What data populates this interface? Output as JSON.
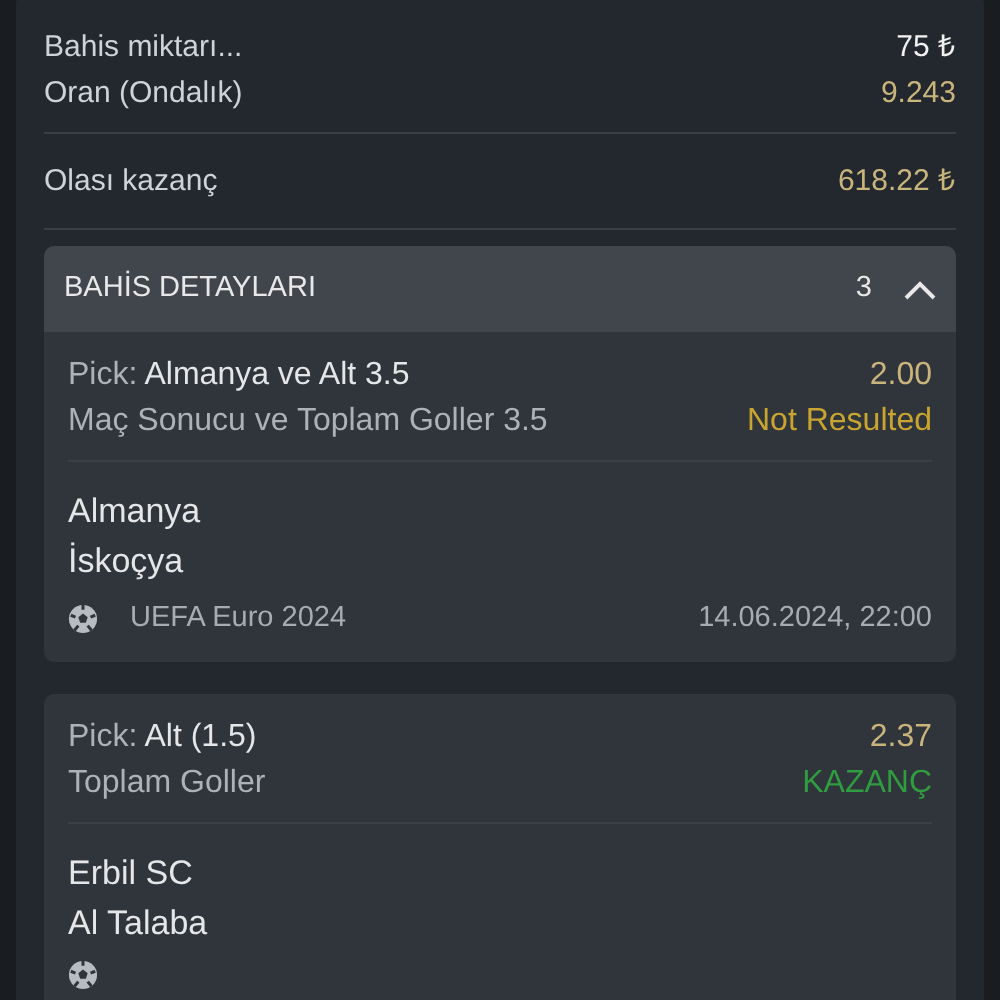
{
  "summary": [
    {
      "label": "Bahis miktarı...",
      "value": "75 ₺",
      "kind": "amount"
    },
    {
      "label": "Oran (Ondalık)",
      "value": "9.243",
      "kind": "odds"
    }
  ],
  "potential": {
    "label": "Olası kazanç",
    "value": "618.22 ₺"
  },
  "details": {
    "title": "BAHİS DETAYLARI",
    "count": "3",
    "expanded": true,
    "bets": [
      {
        "pick_label": "Pick:",
        "pick": "Almanya ve Alt 3.5",
        "odds": "2.00",
        "market": "Maç Sonucu ve Toplam Goller 3.5",
        "status": "Not Resulted",
        "kind": "pending",
        "teams": [
          "Almanya",
          "İskoçya"
        ],
        "league": "UEFA Euro 2024",
        "date": "14.06.2024, 22:00"
      },
      {
        "pick_label": "Pick:",
        "pick": "Alt (1.5)",
        "odds": "2.37",
        "market": "Toplam Goller",
        "status": "KAZANÇ",
        "kind": "won",
        "teams": [
          "Erbil SC",
          "Al Talaba"
        ]
      }
    ]
  }
}
